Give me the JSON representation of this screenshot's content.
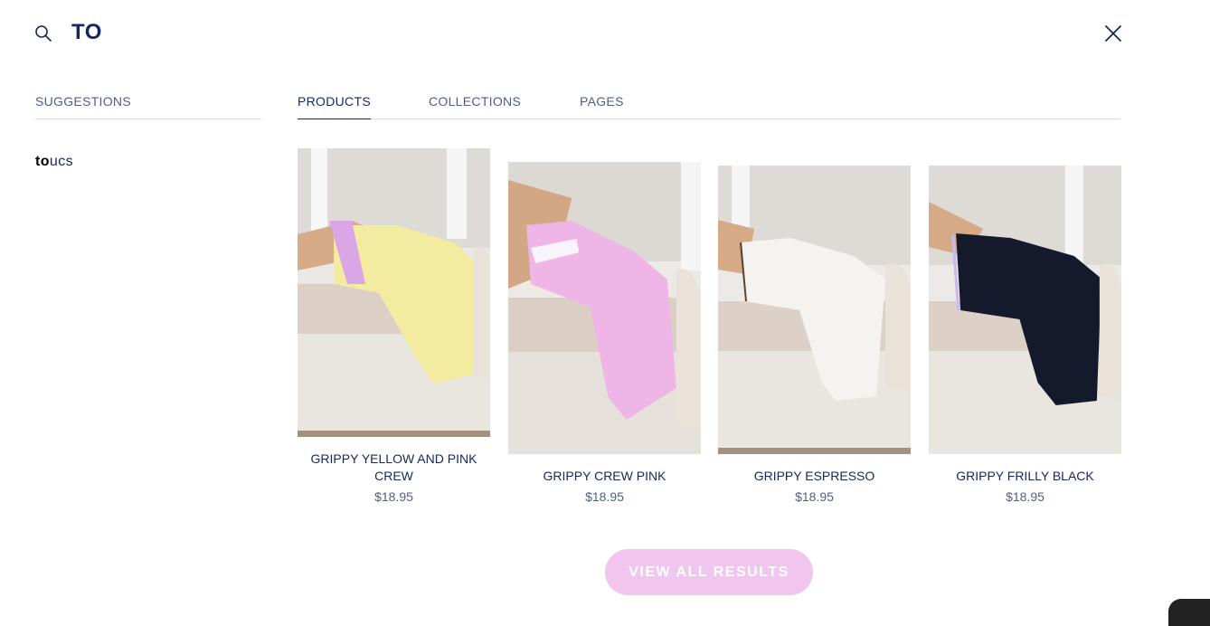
{
  "search": {
    "query": "TO"
  },
  "suggestions": {
    "heading": "SUGGESTIONS",
    "items": [
      {
        "match": "to",
        "rest": "ucs"
      }
    ]
  },
  "tabs": [
    {
      "label": "PRODUCTS",
      "active": true
    },
    {
      "label": "COLLECTIONS",
      "active": false
    },
    {
      "label": "PAGES",
      "active": false
    }
  ],
  "products": [
    {
      "name": "GRIPPY YELLOW AND PINK CREW",
      "price": "$18.95",
      "sock_color": "#f3eca0",
      "stripe_color": "#d9a7e6"
    },
    {
      "name": "GRIPPY CREW PINK",
      "price": "$18.95",
      "sock_color": "#efb5e6",
      "stripe_color": "#f7f4fb"
    },
    {
      "name": "GRIPPY ESPRESSO",
      "price": "$18.95",
      "sock_color": "#f5f3ef",
      "stripe_color": "#5a4638"
    },
    {
      "name": "GRIPPY FRILLY BLACK",
      "price": "$18.95",
      "sock_color": "#141a2c",
      "stripe_color": "#c9b9f2"
    }
  ],
  "view_all": {
    "label": "VIEW ALL RESULTS"
  },
  "colors": {
    "brand_navy": "#14285a",
    "muted_blue": "#4d5f85",
    "button_pink": "#f1c6ee"
  }
}
